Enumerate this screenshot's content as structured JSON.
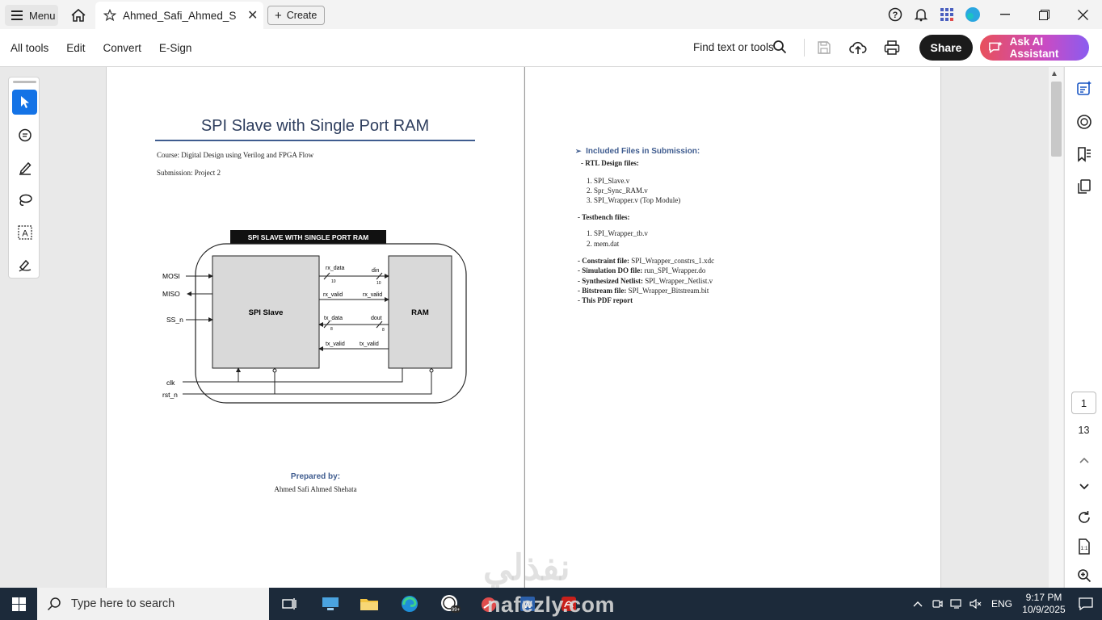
{
  "window": {
    "menu_label": "Menu",
    "tab_title": "Ahmed_Safi_Ahmed_S...",
    "create_label": "Create"
  },
  "toolbar": {
    "items": [
      "All tools",
      "Edit",
      "Convert",
      "E-Sign"
    ],
    "find_label": "Find text or tools",
    "share_label": "Share",
    "ai_label": "Ask AI Assistant"
  },
  "page1": {
    "title": "SPI Slave with Single Port RAM",
    "course": "Course: Digital Design using Verilog and FPGA Flow",
    "submission": "Submission: Project 2",
    "prepared_by": "Prepared by:",
    "author": "Ahmed Safi Ahmed Shehata",
    "diagram": {
      "banner": "SPI SLAVE WITH SINGLE PORT RAM",
      "left_block": "SPI Slave",
      "right_block": "RAM",
      "inputs": [
        "MOSI",
        "MISO",
        "SS_n",
        "clk",
        "rst_n"
      ],
      "signals": {
        "rx_data": "rx_data",
        "rx_data_w": "10",
        "din": "din",
        "din_w": "10",
        "rx_valid_l": "rx_valid",
        "rx_valid_r": "rx_valid",
        "tx_data": "tx_data",
        "tx_data_w": "8",
        "dout": "dout",
        "dout_w": "8",
        "tx_valid_l": "tx_valid",
        "tx_valid_r": "tx_valid"
      }
    }
  },
  "page2": {
    "heading": "Included Files in Submission:",
    "rtl_label": "- RTL Design files:",
    "rtl_files": [
      "1.  SPI_Slave.v",
      "2.  Spr_Sync_RAM.v",
      "3.  SPI_Wrapper.v (Top Module)"
    ],
    "tb_label": "- Testbench files:",
    "tb_files": [
      "1.  SPI_Wrapper_tb.v",
      "2.  mem.dat"
    ],
    "other": [
      {
        "label": "- Constraint file:",
        "value": " SPI_Wrapper_constrs_1.xdc"
      },
      {
        "label": "- Simulation DO file:",
        "value": " run_SPI_Wrapper.do"
      },
      {
        "label": "- Synthesized Netlist:",
        "value": "  SPI_Wrapper_Netlist.v"
      },
      {
        "label": "- Bitstream file:",
        "value": " SPI_Wrapper_Bitstream.bit"
      },
      {
        "label": "- This PDF report",
        "value": ""
      }
    ]
  },
  "navigation": {
    "current_page": "1",
    "total_pages": "13"
  },
  "watermark": {
    "arabic": "نفذلي",
    "latin": "nafezly.com"
  },
  "taskbar": {
    "search_placeholder": "Type here to search",
    "language": "ENG",
    "time": "9:17 PM",
    "date": "10/9/2025",
    "badge": "99+"
  }
}
